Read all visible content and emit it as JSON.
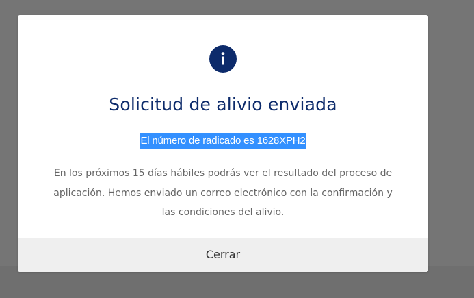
{
  "modal": {
    "icon": "info-icon",
    "title": "Solicitud de alivio enviada",
    "radicado_text": "El número de radicado es 1628XPH2",
    "message_lines": [
      "En los próximos 15 días hábiles podrás ver el resultado del proceso de",
      "aplicación. Hemos enviado un correo electrónico con la confirmación y",
      "las condiciones del alivio."
    ],
    "close_label": "Cerrar"
  },
  "colors": {
    "overlay": "#757575",
    "brand_navy": "#0d2b6b",
    "selection_highlight": "#3390ff",
    "footer_bg": "#efefef",
    "body_text": "#666666"
  }
}
